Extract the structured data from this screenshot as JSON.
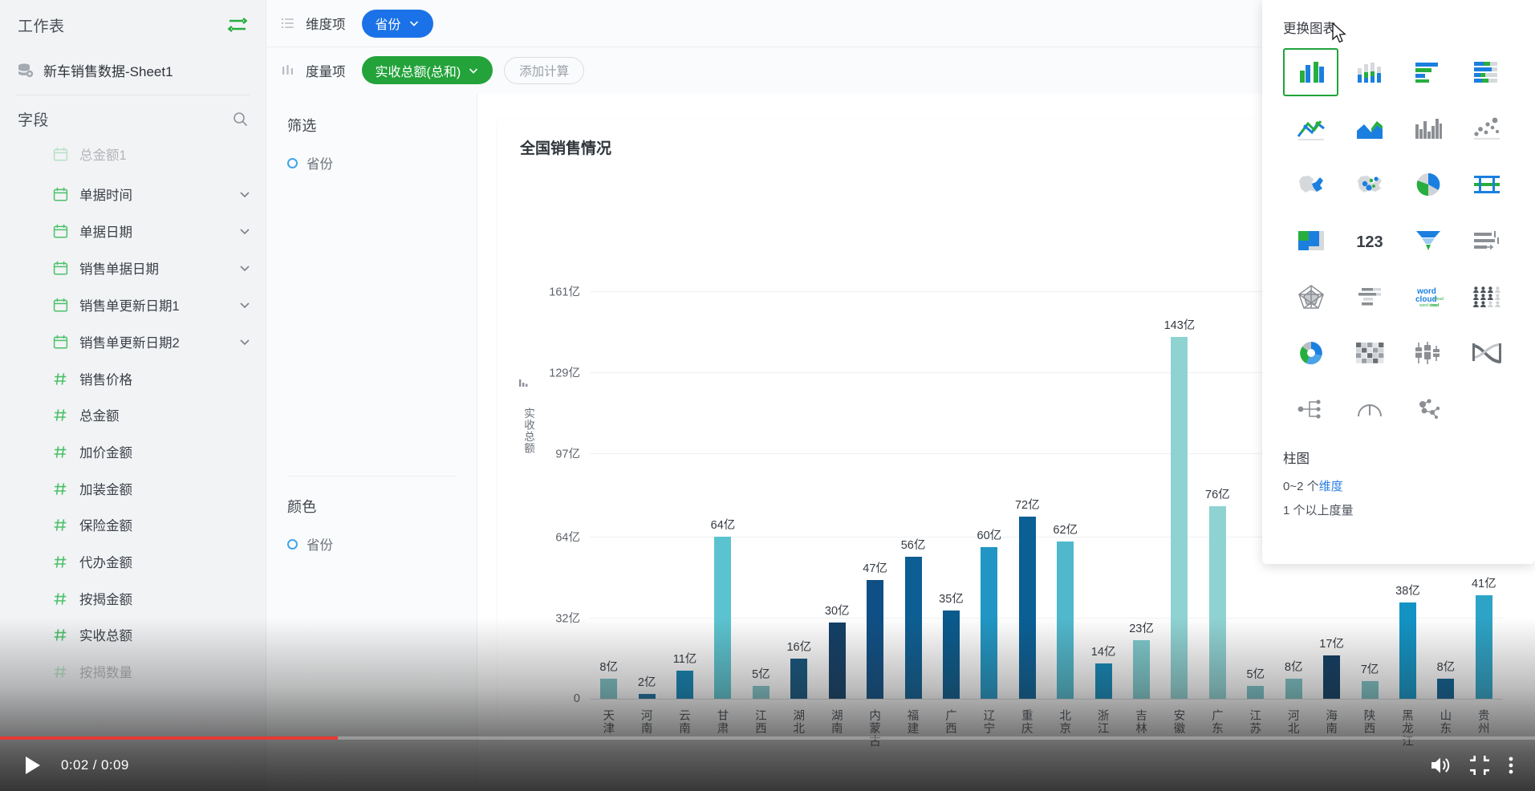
{
  "sidebar": {
    "worksheet_header": "工作表",
    "sync_icon": "sync-icon",
    "worksheet_item": {
      "label": "新车销售数据-Sheet1",
      "icon": "database-gear-icon"
    },
    "fields_header": "字段",
    "search_icon": "search-icon",
    "fields": [
      {
        "label": "总金额1",
        "type": "calendar-icon",
        "expandable": false,
        "clipped": true
      },
      {
        "label": "单据时间",
        "type": "calendar-icon",
        "expandable": true
      },
      {
        "label": "单据日期",
        "type": "calendar-icon",
        "expandable": true
      },
      {
        "label": "销售单据日期",
        "type": "calendar-icon",
        "expandable": true
      },
      {
        "label": "销售单更新日期1",
        "type": "calendar-icon",
        "expandable": true
      },
      {
        "label": "销售单更新日期2",
        "type": "calendar-icon",
        "expandable": true
      },
      {
        "label": "销售价格",
        "type": "hash-icon",
        "expandable": false
      },
      {
        "label": "总金额",
        "type": "hash-icon",
        "expandable": false
      },
      {
        "label": "加价金额",
        "type": "hash-icon",
        "expandable": false
      },
      {
        "label": "加装金额",
        "type": "hash-icon",
        "expandable": false
      },
      {
        "label": "保险金额",
        "type": "hash-icon",
        "expandable": false
      },
      {
        "label": "代办金额",
        "type": "hash-icon",
        "expandable": false
      },
      {
        "label": "按揭金额",
        "type": "hash-icon",
        "expandable": false
      },
      {
        "label": "实收总额",
        "type": "hash-icon",
        "expandable": false
      },
      {
        "label": "按揭数量",
        "type": "hash-icon",
        "expandable": false,
        "clipped": true
      }
    ]
  },
  "toolbar": {
    "dimension_label": "维度项",
    "dimension_icon": "list-icon",
    "dimension_pill": "省份",
    "measure_label": "度量项",
    "measure_icon": "bars-icon",
    "measure_pill": "实收总额(总和)",
    "add_calc_button": "添加计算",
    "chevron_icon": "chevron-down-icon"
  },
  "config_panel": {
    "filter_title": "筛选",
    "filter_chip": "省份",
    "color_title": "颜色",
    "color_chip": "省份"
  },
  "picker": {
    "title": "更换图表",
    "selected_index": 0,
    "items": [
      {
        "name": "column-chart-icon"
      },
      {
        "name": "stacked-column-chart-icon"
      },
      {
        "name": "bar-chart-icon"
      },
      {
        "name": "stacked-bar-chart-icon"
      },
      {
        "name": "line-chart-icon"
      },
      {
        "name": "area-chart-icon"
      },
      {
        "name": "histogram-chart-icon"
      },
      {
        "name": "scatter-chart-icon"
      },
      {
        "name": "map-region-icon"
      },
      {
        "name": "map-bubble-icon"
      },
      {
        "name": "pie-chart-icon"
      },
      {
        "name": "gantt-chart-icon"
      },
      {
        "name": "treemap-chart-icon"
      },
      {
        "name": "kpi-number-icon"
      },
      {
        "name": "funnel-chart-icon"
      },
      {
        "name": "progress-bar-icon"
      },
      {
        "name": "radar-chart-icon"
      },
      {
        "name": "bullet-chart-icon"
      },
      {
        "name": "word-cloud-icon"
      },
      {
        "name": "pictogram-chart-icon"
      },
      {
        "name": "donut-chart-icon"
      },
      {
        "name": "heatmap-chart-icon"
      },
      {
        "name": "box-plot-icon"
      },
      {
        "name": "sankey-chart-icon"
      },
      {
        "name": "tree-diagram-icon"
      },
      {
        "name": "gauge-chart-icon"
      },
      {
        "name": "network-graph-icon"
      }
    ],
    "footer_title": "柱图",
    "footer_line1_prefix": "0~2 个",
    "footer_line1_link": "维度",
    "footer_line2": "1 个以上度量"
  },
  "player": {
    "play_icon": "play-icon",
    "time": "0:02 / 0:09",
    "volume_icon": "volume-icon",
    "fullscreen_exit_icon": "collapse-icon",
    "more_icon": "more-vertical-icon"
  },
  "chart_data": {
    "type": "bar",
    "title": "全国销售情况",
    "xlabel": "",
    "ylabel": "实收总额",
    "unit": "亿",
    "ylim": [
      0,
      161
    ],
    "yticks": [
      0,
      32,
      64,
      97,
      129,
      161
    ],
    "ytick_labels": [
      "0",
      "32亿",
      "64亿",
      "97亿",
      "129亿",
      "161亿"
    ],
    "grid": true,
    "legend": "none",
    "categories": [
      "天津",
      "河南",
      "云南",
      "甘肃",
      "江西",
      "湖北",
      "湖南",
      "内蒙古",
      "福建",
      "广西",
      "辽宁",
      "重庆",
      "北京",
      "浙江",
      "吉林",
      "安徽",
      "广东",
      "江苏",
      "河北",
      "海南",
      "陕西",
      "黑龙江",
      "山东",
      "贵州"
    ],
    "values": [
      8,
      2,
      11,
      64,
      5,
      16,
      30,
      47,
      56,
      35,
      60,
      72,
      62,
      14,
      23,
      143,
      76,
      5,
      8,
      17,
      7,
      38,
      8,
      41
    ],
    "value_labels": [
      "8亿",
      "2亿",
      "11亿",
      "64亿",
      "5亿",
      "16亿",
      "30亿",
      "47亿",
      "56亿",
      "35亿",
      "60亿",
      "72亿",
      "62亿",
      "14亿",
      "23亿",
      "143亿",
      "76亿",
      "5亿",
      "8亿",
      "17亿",
      "7亿",
      "38亿",
      "8亿",
      "41亿"
    ],
    "colors": [
      "#7cc2c4",
      "#1b6f9e",
      "#1284b5",
      "#5bc3cf",
      "#81c4c8",
      "#15567e",
      "#133f66",
      "#0f4f85",
      "#0d5e92",
      "#0a5a8c",
      "#2196c4",
      "#0a5f95",
      "#50b8cc",
      "#1288b8",
      "#7ecacd",
      "#8fd2d2",
      "#8fd2d2",
      "#79c1c6",
      "#7cc2c4",
      "#103d63",
      "#7cc2c4",
      "#1293c4",
      "#0d5f92",
      "#2da3c6"
    ],
    "accent_blue": "#1b72e8",
    "accent_green": "#23a33a"
  }
}
